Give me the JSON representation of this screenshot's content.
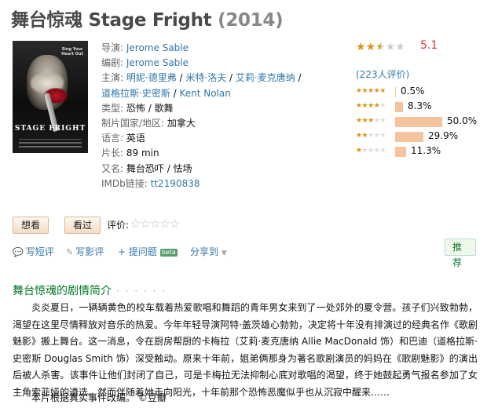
{
  "movie": {
    "title_zh": "舞台惊魂",
    "title_en": "Stage Fright",
    "year": "(2014)"
  },
  "poster": {
    "tagline": "Sing Your Heart Out",
    "title": "STAGE FRIGHT"
  },
  "info": {
    "director_label": "导演:",
    "director": "Jerome Sable",
    "writer_label": "编剧:",
    "writer": "Jerome Sable",
    "cast_label": "主演:",
    "cast": [
      "明妮·德里弗",
      "米特·洛夫",
      "艾莉·麦克唐纳",
      "道格拉斯·史密斯",
      "Kent Nolan"
    ],
    "genre_label": "类型:",
    "genre": "恐怖 / 歌舞",
    "country_label": "制片国家/地区:",
    "country": "加拿大",
    "language_label": "语言:",
    "language": "英语",
    "runtime_label": "片长:",
    "runtime": "89 min",
    "aka_label": "又名:",
    "aka": "舞台恐吓 / 怯场",
    "imdb_label": "IMDb链接:",
    "imdb": "tt2190838"
  },
  "rating": {
    "stars_filled": 2.5,
    "score": "5.1",
    "votes": "(223人评价)",
    "distribution": [
      {
        "stars": 5,
        "percent": 0.5,
        "label": "0.5%"
      },
      {
        "stars": 4,
        "percent": 8.3,
        "label": "8.3%"
      },
      {
        "stars": 3,
        "percent": 50.0,
        "label": "50.0%"
      },
      {
        "stars": 2,
        "percent": 29.9,
        "label": "29.9%"
      },
      {
        "stars": 1,
        "percent": 11.3,
        "label": "11.3%"
      }
    ],
    "accent_color": "#e09015",
    "score_color": "#e03030",
    "bar_color": "#f4c49f"
  },
  "actions": {
    "want_label": "想看",
    "seen_label": "看过",
    "rate_label": "评价:"
  },
  "tools": {
    "short_review": "写短评",
    "review": "写影评",
    "ask": "+ 提问题",
    "beta": "beta",
    "share": "分享到",
    "recommend": "推荐"
  },
  "summary": {
    "heading": "舞台惊魂的剧情简介",
    "dots": "· · · · · ·",
    "text": "炎炎夏日，一辆辆黄色的校车载着热爱歌唱和舞蹈的青年男女来到了一处郊外的夏令营。孩子们兴致勃勃，渴望在这里尽情释放对音乐的热爱。今年年轻导演阿特·盖茨雄心勃勃，决定将十年没有排演过的经典名作《歌剧魅影》搬上舞台。这一消息，令在厨房帮厨的卡梅拉（艾莉·麦克唐纳 Allie MacDonald 饰）和巴迪（道格拉斯·史密斯 Douglas Smith 饰）深受触动。原来十年前，姐弟俩那身为著名歌剧演员的妈妈在《歌剧魅影》的演出后被人杀害。该事件让他们封闭了自己，可是卡梅拉无法抑制心底对歌唱的渴望，终于她鼓起勇气报名参加了女主角索菲娅的遴选。然而伴随着她走向阳光，十年前那个恐怖恶魔似乎也从沉寂中醒来……",
    "note": "本片根据真实事件改编。 ©豆瓣"
  }
}
